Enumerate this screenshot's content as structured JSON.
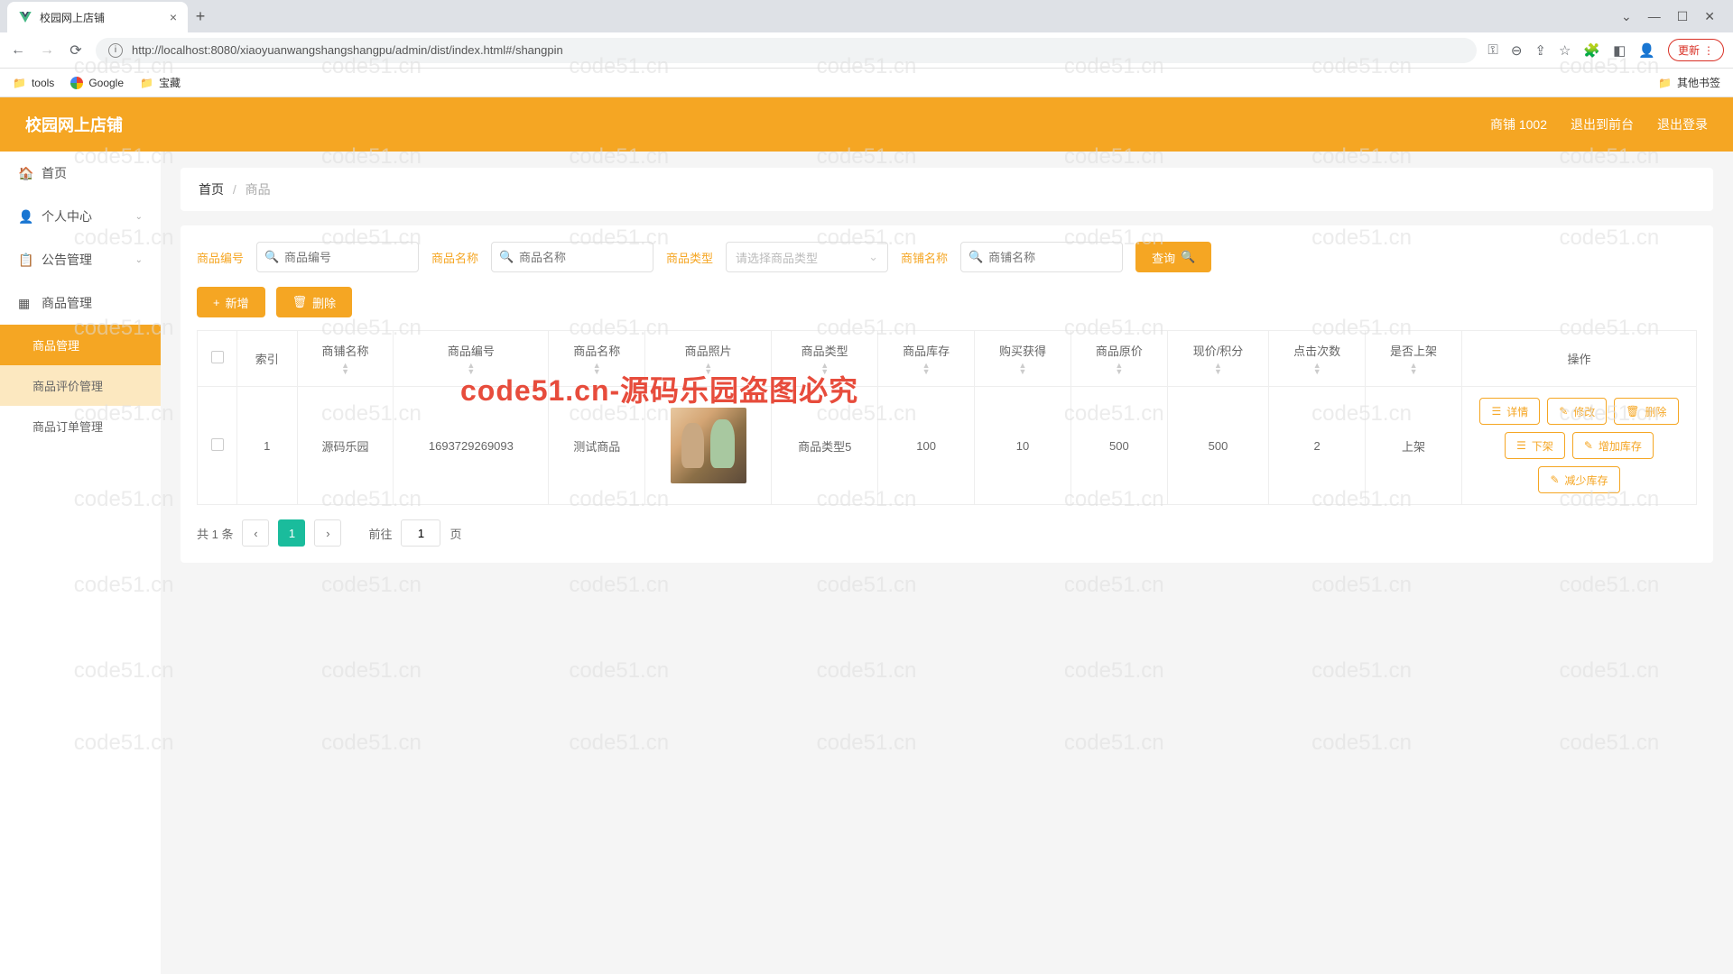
{
  "browser": {
    "tab_title": "校园网上店铺",
    "url": "http://localhost:8080/xiaoyuanwangshangshangpu/admin/dist/index.html#/shangpin",
    "update_label": "更新",
    "bookmarks": {
      "tools": "tools",
      "google": "Google",
      "baozang": "宝藏",
      "other": "其他书签"
    }
  },
  "header": {
    "brand": "校园网上店铺",
    "shop_info": "商铺 1002",
    "logout_front": "退出到前台",
    "logout": "退出登录"
  },
  "sidebar": {
    "home": "首页",
    "personal": "个人中心",
    "notice": "公告管理",
    "product": "商品管理",
    "sub": {
      "product_mgmt": "商品管理",
      "review_mgmt": "商品评价管理",
      "order_mgmt": "商品订单管理"
    }
  },
  "breadcrumb": {
    "home": "首页",
    "current": "商品"
  },
  "filters": {
    "code_label": "商品编号",
    "code_placeholder": "商品编号",
    "name_label": "商品名称",
    "name_placeholder": "商品名称",
    "type_label": "商品类型",
    "type_placeholder": "请选择商品类型",
    "shop_label": "商铺名称",
    "shop_placeholder": "商铺名称",
    "search_btn": "查询"
  },
  "toolbar": {
    "add": "新增",
    "delete": "删除"
  },
  "table": {
    "headers": {
      "index": "索引",
      "shop_name": "商铺名称",
      "code": "商品编号",
      "name": "商品名称",
      "photo": "商品照片",
      "type": "商品类型",
      "stock": "商品库存",
      "reward": "购买获得",
      "orig_price": "商品原价",
      "cur_price": "现价/积分",
      "clicks": "点击次数",
      "onshelf": "是否上架",
      "ops": "操作"
    },
    "rows": [
      {
        "index": "1",
        "shop_name": "源码乐园",
        "code": "1693729269093",
        "name": "测试商品",
        "type": "商品类型5",
        "stock": "100",
        "reward": "10",
        "orig_price": "500",
        "cur_price": "500",
        "clicks": "2",
        "onshelf": "上架"
      }
    ],
    "row_actions": {
      "detail": "详情",
      "edit": "修改",
      "delete": "删除",
      "offshelf": "下架",
      "add_stock": "增加库存",
      "reduce_stock": "减少库存"
    }
  },
  "pagination": {
    "total_text": "共 1 条",
    "current": "1",
    "goto_prefix": "前往",
    "goto_suffix": "页",
    "goto_value": "1"
  },
  "watermark": {
    "text": "code51.cn",
    "big": "code51.cn-源码乐园盗图必究"
  }
}
